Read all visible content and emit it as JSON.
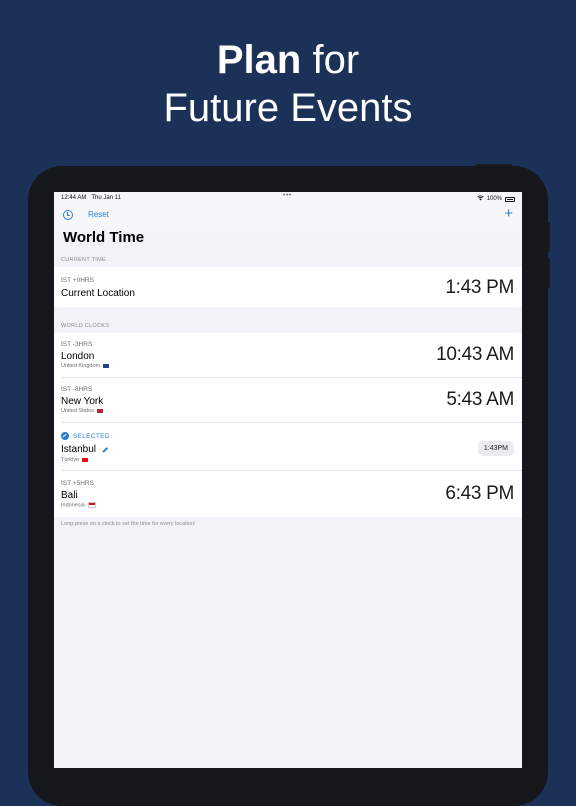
{
  "headline": {
    "bold": "Plan",
    "rest_line1": " for",
    "line2": "Future Events"
  },
  "status": {
    "time": "12:44 AM",
    "date": "Thu Jan 11",
    "dots": "•••",
    "wifi_icon": "wifi-icon",
    "battery": "100%"
  },
  "nav": {
    "reset_label": "Reset",
    "add_label": "+",
    "title": "World Time"
  },
  "current_section": {
    "label": "CURRENT TIME",
    "offset": "IST +0HRS",
    "city": "Current Location",
    "time": "1:43 PM"
  },
  "world_section": {
    "label": "WORLD CLOCKS"
  },
  "clocks": [
    {
      "offset": "IST -3HRS",
      "city": "London",
      "country": "United Kingdom",
      "time": "10:43 AM",
      "flag_color": "#1f3f8c"
    },
    {
      "offset": "IST -8HRS",
      "city": "New York",
      "country": "United States",
      "time": "5:43 AM",
      "flag_color": "#b22234"
    },
    {
      "selected_label": "SELECTED",
      "city": "Istanbul",
      "country": "Türkiye",
      "time": "1:43PM",
      "flag_color": "#e30a17"
    },
    {
      "offset": "IST +5HRS",
      "city": "Bali",
      "country": "Indonesia",
      "time": "6:43 PM",
      "flag_color": "#ce1126"
    }
  ],
  "footer": {
    "note": "Long press on a clock to set the time for every location!"
  },
  "colors": {
    "background": "#1b3157",
    "accent": "#2a7fd4"
  }
}
